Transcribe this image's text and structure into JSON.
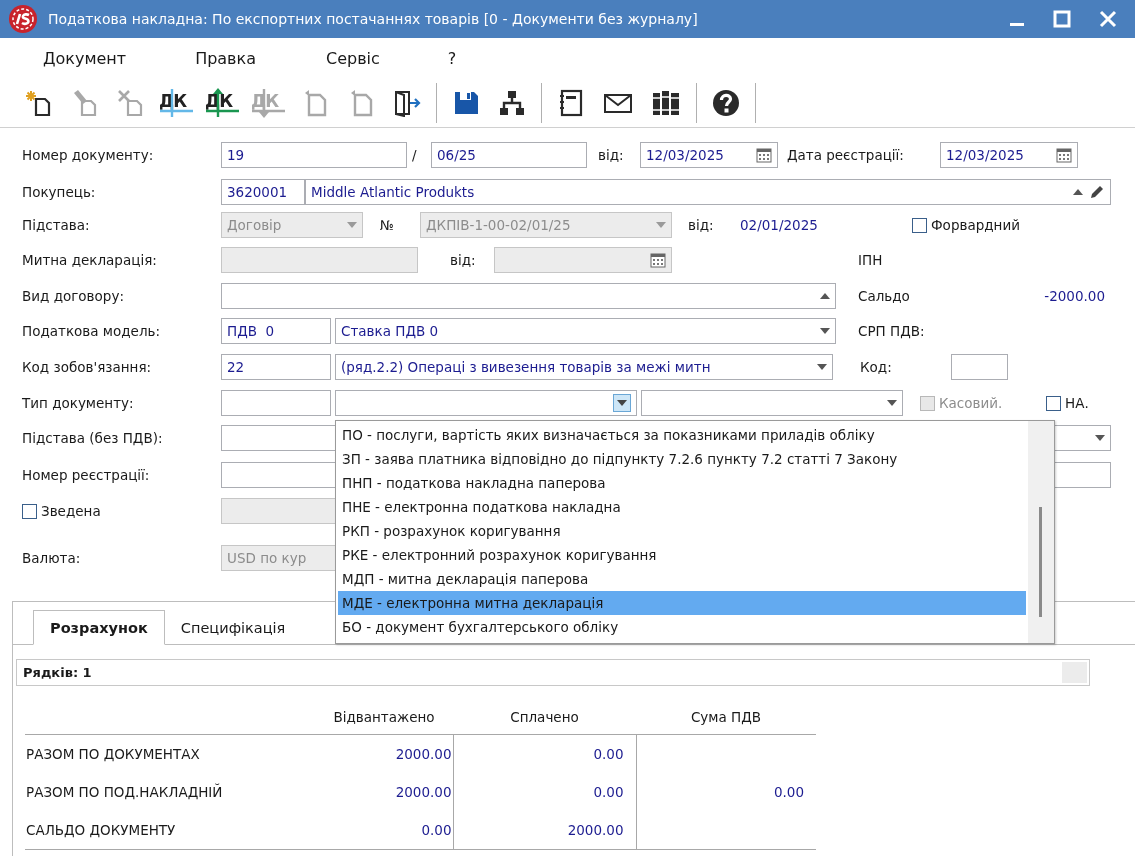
{
  "window": {
    "title": "Податкова накладна: По експортних  постачаннях товарів [0 - Документи без журналу]"
  },
  "menu": [
    "Документ",
    "Правка",
    "Сервіс",
    "?"
  ],
  "toolbar": [
    {
      "kind": "new",
      "disabled": false
    },
    {
      "kind": "edit",
      "disabled": true
    },
    {
      "kind": "delete",
      "disabled": true
    },
    {
      "kind": "dk",
      "glyph": "ДК",
      "up_arrow": false,
      "down_arrow": false,
      "disabled": false
    },
    {
      "kind": "dk",
      "glyph": "ДК",
      "up_arrow": true,
      "down_arrow": false,
      "disabled": false
    },
    {
      "kind": "dk",
      "glyph": "ДК",
      "up_arrow": false,
      "down_arrow": true,
      "disabled": true
    },
    {
      "kind": "copy",
      "disabled": true
    },
    {
      "kind": "copy",
      "disabled": true
    },
    {
      "kind": "exit",
      "disabled": false
    },
    {
      "kind": "separator"
    },
    {
      "kind": "save",
      "disabled": false
    },
    {
      "kind": "tree",
      "disabled": false
    },
    {
      "kind": "separator"
    },
    {
      "kind": "notebook",
      "disabled": false
    },
    {
      "kind": "mail",
      "disabled": false
    },
    {
      "kind": "books",
      "disabled": false
    },
    {
      "kind": "separator"
    },
    {
      "kind": "help",
      "disabled": false
    },
    {
      "kind": "separator"
    }
  ],
  "form": {
    "rows": [
      {
        "items": [
          {
            "kind": "label",
            "text": "Номер документу:"
          },
          {
            "kind": "field",
            "value": "19",
            "disabled": false
          },
          {
            "kind": "label",
            "text": "/"
          },
          {
            "kind": "field",
            "value": "06/25",
            "disabled": false
          },
          {
            "kind": "label",
            "text": "від:"
          },
          {
            "kind": "date",
            "value": "12/03/2025",
            "disabled": false
          },
          {
            "kind": "label",
            "text": "Дата реєстрації:"
          },
          {
            "kind": "date",
            "value": "12/03/2025",
            "disabled": false
          }
        ]
      },
      {
        "items": [
          {
            "kind": "label",
            "text": "Покупець:"
          },
          {
            "kind": "field",
            "value": "3620001",
            "disabled": false
          },
          {
            "kind": "lookup",
            "value": "Middle Atlantic Produkts",
            "disabled": false
          }
        ]
      },
      {
        "items": [
          {
            "kind": "label",
            "text": "Підстава:"
          },
          {
            "kind": "combo",
            "value": "Договір",
            "disabled": true
          },
          {
            "kind": "label",
            "text": "№"
          },
          {
            "kind": "combo",
            "value": "ДКПІВ-1-00-02/01/25",
            "disabled": true
          },
          {
            "kind": "label",
            "text": "від:"
          },
          {
            "kind": "amount",
            "text": "02/01/2025"
          },
          {
            "kind": "checkbox",
            "label": "Форвардний",
            "checked": false,
            "disabled": false
          }
        ]
      },
      {
        "items": [
          {
            "kind": "label",
            "text": "Митна декларація:"
          },
          {
            "kind": "field",
            "disabled": true
          },
          {
            "kind": "label",
            "text": "від:"
          },
          {
            "kind": "date",
            "disabled": true
          },
          {
            "kind": "label",
            "text": "ІПН"
          }
        ]
      },
      {
        "items": [
          {
            "kind": "label",
            "text": "Вид договору:"
          },
          {
            "kind": "upfield",
            "disabled": false
          },
          {
            "kind": "label",
            "text": "Сальдо"
          },
          {
            "kind": "amount",
            "text": "-2000.00"
          }
        ]
      },
      {
        "items": [
          {
            "kind": "label",
            "text": "Податкова модель:"
          },
          {
            "kind": "field",
            "value": "ПДВ  0",
            "disabled": false
          },
          {
            "kind": "combo",
            "value": "Ставка ПДВ 0",
            "disabled": false
          },
          {
            "kind": "label",
            "text": "СРП ПДВ:"
          }
        ]
      },
      {
        "items": [
          {
            "kind": "label",
            "text": "Код зобов'язання:"
          },
          {
            "kind": "field",
            "value": "22",
            "disabled": false
          },
          {
            "kind": "combo",
            "value": "(ряд.2.2) Операці з вивезення товарів за межі митн",
            "disabled": false
          },
          {
            "kind": "label",
            "text": "Код:"
          },
          {
            "kind": "field",
            "disabled": false
          }
        ]
      },
      {
        "items": [
          {
            "kind": "label",
            "text": "Тип документу:"
          },
          {
            "kind": "field",
            "disabled": false
          },
          {
            "kind": "combo",
            "disabled": false,
            "open": true
          },
          {
            "kind": "combo",
            "disabled": false
          },
          {
            "kind": "checkbox",
            "label": "Касовий.",
            "checked": false,
            "disabled": true
          },
          {
            "kind": "checkbox",
            "label": "НА.",
            "checked": false,
            "disabled": false
          }
        ]
      },
      {
        "items": [
          {
            "kind": "label",
            "text": "Підстава (без ПДВ):"
          },
          {
            "kind": "combo",
            "disabled": false
          }
        ]
      },
      {
        "items": [
          {
            "kind": "label",
            "text": "Номер реєстрації:"
          },
          {
            "kind": "field",
            "disabled": false
          }
        ]
      },
      {
        "items": [
          {
            "kind": "checkbox",
            "label": "Зведена",
            "checked": false,
            "disabled": false
          },
          {
            "kind": "field",
            "disabled": true
          }
        ]
      },
      {
        "items": [
          {
            "kind": "label",
            "text": "Валюта:"
          },
          {
            "kind": "field",
            "value": "USD по кур",
            "disabled": true
          }
        ]
      }
    ]
  },
  "type_dropdown": {
    "items": [
      {
        "label": "ПО - послуги, вартість яких визначається за показниками приладів обліку",
        "selected": false
      },
      {
        "label": "ЗП - заява платника відповідно до підпункту 7.2.6 пункту 7.2 статті 7 Закону",
        "selected": false
      },
      {
        "label": "ПНП - податкова накладна паперова",
        "selected": false
      },
      {
        "label": "ПНЕ - електронна податкова накладна",
        "selected": false
      },
      {
        "label": "РКП - розрахунок  коригування",
        "selected": false
      },
      {
        "label": "РКЕ - електронний розрахунок коригування",
        "selected": false
      },
      {
        "label": "МДП - митна  декларація паперова",
        "selected": false
      },
      {
        "label": "МДЕ - електронна митна декларація",
        "selected": true
      },
      {
        "label": "БО - документ бухгалтерського обліку",
        "selected": false
      }
    ]
  },
  "tabs": [
    {
      "label": "Розрахунок",
      "selected": true
    },
    {
      "label": "Специфікація",
      "selected": false
    }
  ],
  "rows_count": "Рядків: 1",
  "summary": {
    "columns": [
      "Відвантажено",
      "Сплачено",
      "Сума ПДВ"
    ],
    "rows": [
      {
        "label": "РАЗОМ ПО ДОКУМЕНТАХ",
        "cells": [
          "2000.00",
          "0.00"
        ]
      },
      {
        "label": "РАЗОМ ПО ПОД.НАКЛАДНІЙ",
        "cells": [
          "2000.00",
          "0.00",
          "0.00"
        ]
      },
      {
        "label": "САЛЬДО ДОКУМЕНТУ",
        "cells": [
          "0.00",
          "2000.00"
        ]
      }
    ]
  }
}
